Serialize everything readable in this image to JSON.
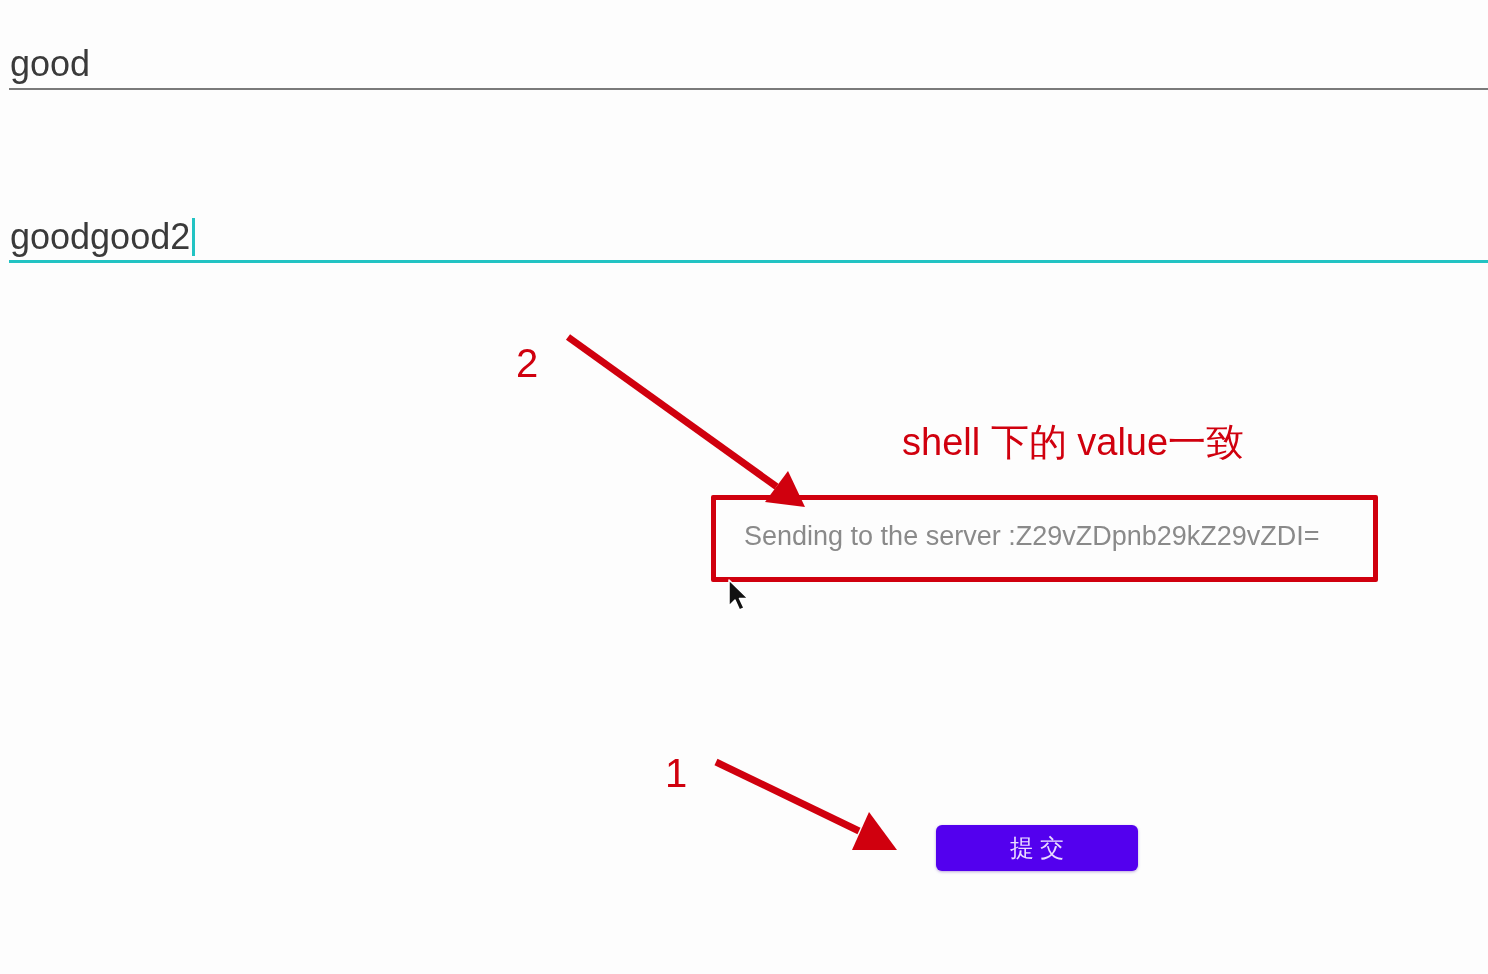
{
  "fields": [
    {
      "value": "good",
      "focused": false
    },
    {
      "value": "goodgood2",
      "focused": true
    }
  ],
  "toast": {
    "text": "Sending to the server :Z29vZDpnb29kZ29vZDI="
  },
  "submit_button": {
    "label": "提交"
  },
  "annotations": {
    "step_numbers": [
      "2",
      "1"
    ],
    "note": "shell 下的 value一致"
  }
}
